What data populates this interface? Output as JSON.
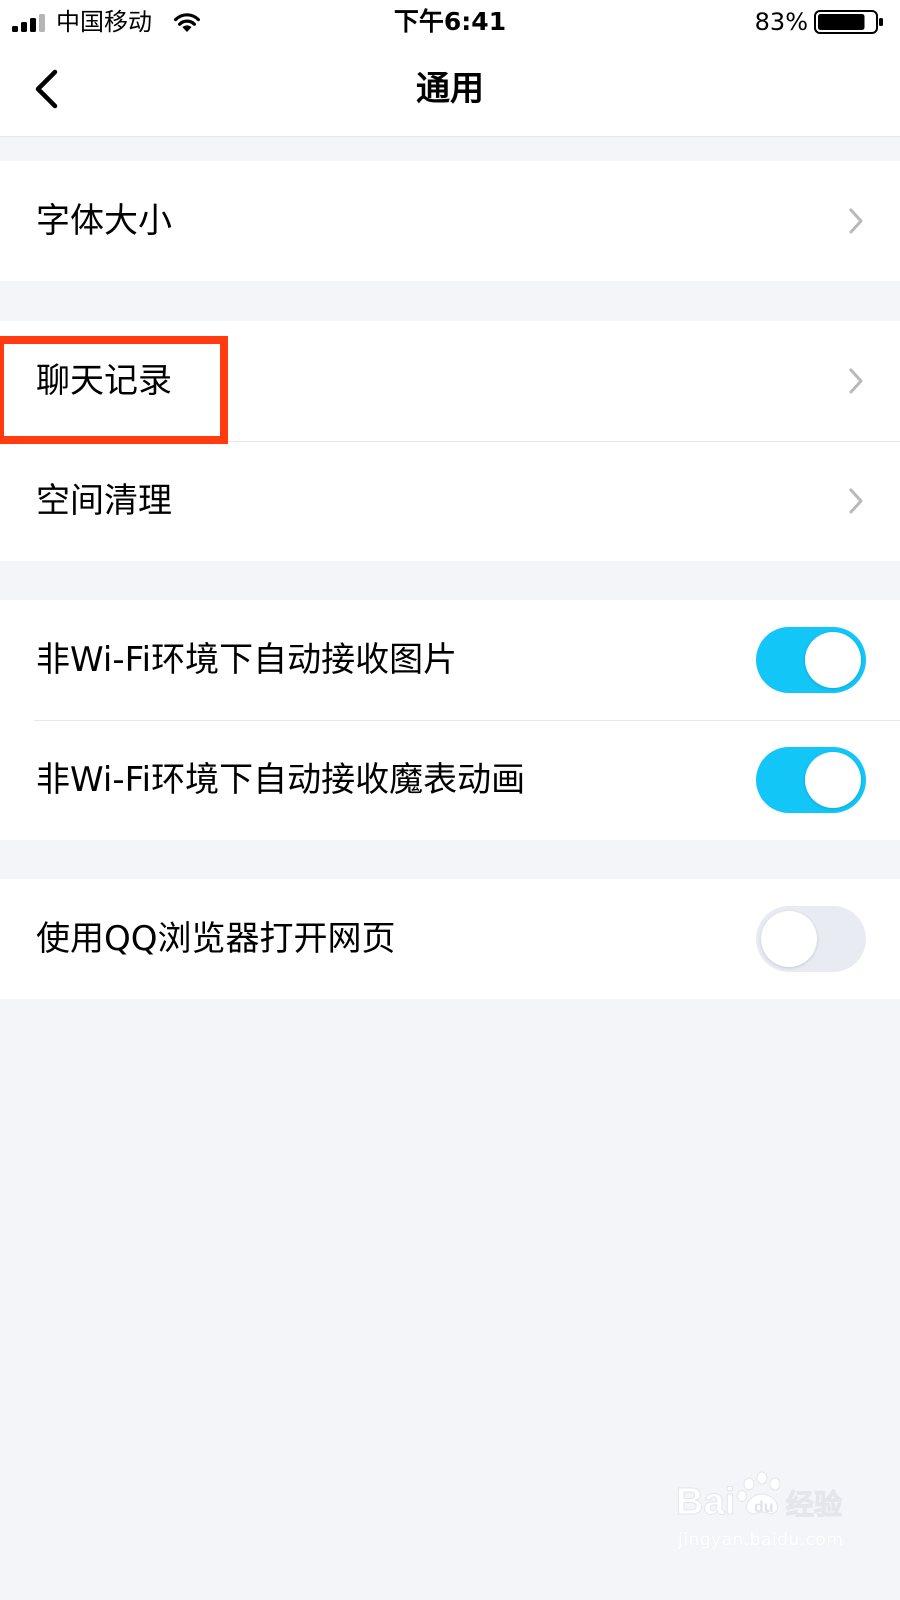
{
  "status_bar": {
    "carrier": "中国移动",
    "time": "下午6:41",
    "battery_percent": "83%",
    "battery_level": 0.83,
    "signal_bars_active": 3,
    "signal_bars_total": 4
  },
  "nav": {
    "title": "通用",
    "back_icon": "chevron-left-icon"
  },
  "groups": [
    {
      "rows": [
        {
          "label": "字体大小",
          "type": "disclosure"
        }
      ]
    },
    {
      "rows": [
        {
          "label": "聊天记录",
          "type": "disclosure",
          "highlighted": true
        },
        {
          "label": "空间清理",
          "type": "disclosure"
        }
      ]
    },
    {
      "rows": [
        {
          "label": "非Wi-Fi环境下自动接收图片",
          "type": "toggle",
          "on": true
        },
        {
          "label": "非Wi-Fi环境下自动接收魔表动画",
          "type": "toggle",
          "on": true
        }
      ]
    },
    {
      "rows": [
        {
          "label": "使用QQ浏览器打开网页",
          "type": "toggle",
          "on": false
        }
      ]
    }
  ],
  "watermark": {
    "logo_text": "Bai 经验",
    "url": "jingyan.baidu.com"
  },
  "colors": {
    "toggle_on": "#12c6f7",
    "toggle_off": "#e8ebf2",
    "highlight": "#ff3b0f",
    "background": "#f4f5f9"
  }
}
